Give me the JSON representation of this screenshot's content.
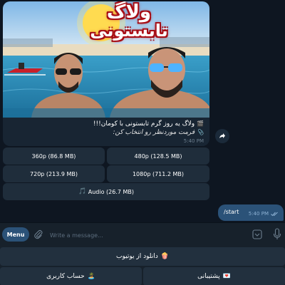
{
  "message": {
    "thumbnail_title_line1": "ولاگ",
    "thumbnail_title_line2": "تابستونی",
    "caption_line1": "ولاگ یه روز گرم تابستونی با کومان!!!",
    "caption_line2": "فرمت موردنظر رو انتخاب کن:",
    "time": "5:40 PM"
  },
  "inline_keyboard": {
    "btn_360": "360p (86.8 MB)",
    "btn_480": "480p (128.5 MB)",
    "btn_720": "720p (213.9 MB)",
    "btn_1080": "1080p (711.2 MB)",
    "btn_audio": "Audio (26.7 MB)"
  },
  "outgoing": {
    "text": "/start",
    "time": "5:40 PM"
  },
  "composer": {
    "menu_label": "Menu",
    "placeholder": "Write a message..."
  },
  "reply_keyboard": {
    "download_youtube": "دانلود از یوتیوب",
    "support": "پشتیبانی",
    "user_account": "حساب کاربری"
  },
  "icons": {
    "caption_icon": "film-clip-icon",
    "audio_icon": "music-note-icon",
    "download_icon": "popcorn-icon",
    "support_icon": "love-letter-icon",
    "account_icon": "island-icon"
  },
  "colors": {
    "background": "#0e1621",
    "bubble": "#182533",
    "outgoing_bubble": "#2b5278",
    "accent": "#2b5278"
  }
}
